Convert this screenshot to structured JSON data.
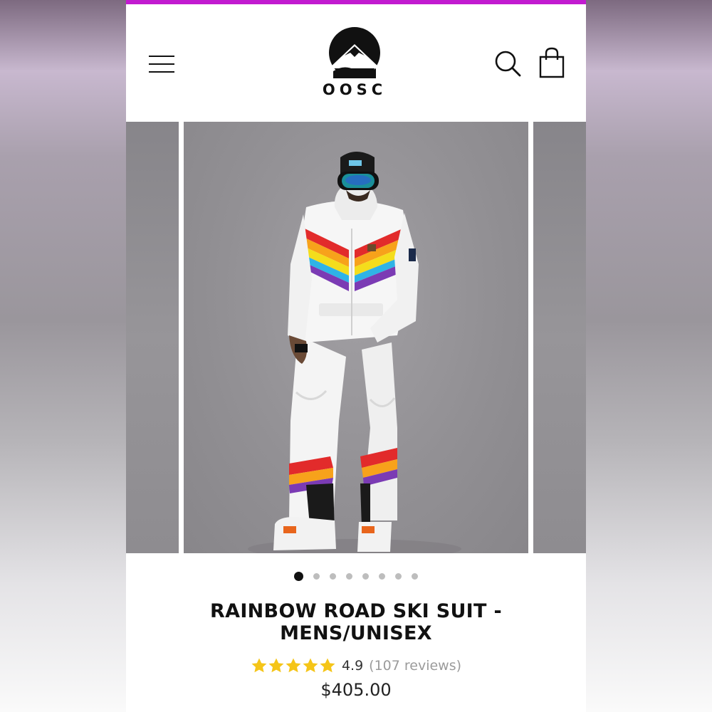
{
  "colors": {
    "accent": "#c21bd0",
    "star": "#f5c518",
    "review_link": "#9b9b9b",
    "text": "#111111"
  },
  "header": {
    "menu_icon": "hamburger-menu-icon",
    "logo_text": "OOSC",
    "search_icon": "search-icon",
    "cart_icon": "shopping-bag-icon"
  },
  "gallery": {
    "main_image": "man in white rainbow-striped ski suit with black beanie and mirrored goggles",
    "zoom_icon": "zoom-magnifier-icon",
    "slide_count": 8,
    "active_slide": 1
  },
  "product": {
    "title_line1": "RAINBOW ROAD SKI SUIT -",
    "title_line2": "MENS/UNISEX",
    "stars": 5,
    "rating": "4.9",
    "reviews": "(107 reviews)",
    "price": "$405.00"
  }
}
